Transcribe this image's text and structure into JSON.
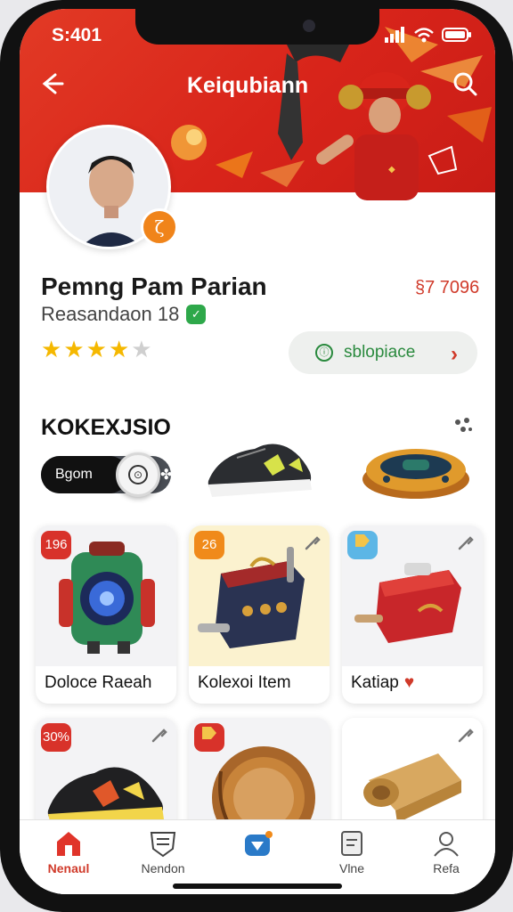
{
  "status_bar": {
    "time": "S:401"
  },
  "header": {
    "title": "Keiqubiann"
  },
  "profile": {
    "name": "Pemng Pam Parian",
    "price": "§7 7096",
    "subtitle": "Reasandaon 18",
    "rating": 4,
    "rating_max": 5,
    "ship_button_label": "sblopiace",
    "badge_glyph": "ζ"
  },
  "collection": {
    "title": "KOKEXJSIO",
    "toggle_label": "Bgom"
  },
  "cards": [
    {
      "badge": "196",
      "badge_color": "#d8322a",
      "caption": "Doloce Raeah"
    },
    {
      "badge": "26",
      "badge_color": "#f08a1a",
      "caption": "Kolexoi Item"
    },
    {
      "badge": "",
      "badge_color": "#5cb6e6",
      "caption": "Katiap"
    },
    {
      "badge": "30%",
      "badge_color": "#d8322a",
      "caption": ""
    },
    {
      "badge": "",
      "badge_color": "#d8322a",
      "caption": ""
    },
    {
      "badge": "",
      "badge_color": "",
      "caption": ""
    }
  ],
  "bottom_nav": [
    {
      "label": "Nenaul",
      "icon": "home-icon",
      "active": true
    },
    {
      "label": "Nendon",
      "icon": "list-icon",
      "active": false
    },
    {
      "label": "",
      "icon": "store-icon",
      "active": false
    },
    {
      "label": "Vlne",
      "icon": "document-icon",
      "active": false
    },
    {
      "label": "Refa",
      "icon": "profile-icon",
      "active": false
    }
  ],
  "colors": {
    "brand_red": "#d8241a",
    "accent_orange": "#f08a1a",
    "success_green": "#2ea84a"
  }
}
